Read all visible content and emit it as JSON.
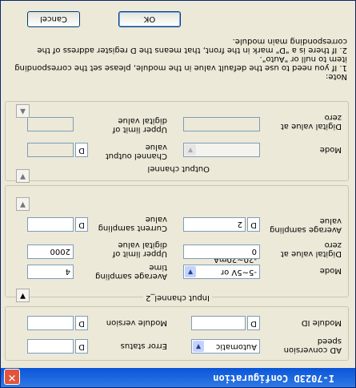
{
  "window": {
    "title": "I-7023D Configuration",
    "close_glyph": "✕"
  },
  "general": {
    "ad_conversion_label": "AD conversion speed",
    "ad_conversion_value": "Automatic",
    "error_status_label": "Error status",
    "module_id_label": "Module ID",
    "module_version_label": "Module version",
    "d_label": "D"
  },
  "input_channel": {
    "title": "Input channel_2",
    "mode_label": "Mode",
    "mode_value": "-5~5V or -20~20mA",
    "average_sampling_time_label": "Average sampling time",
    "average_sampling_time_value": "4",
    "digital_zero_label": "Digital value at zero",
    "digital_zero_value": "0",
    "upper_limit_label": "Upper limit of digital value",
    "upper_limit_value": "2000",
    "average_sampling_value_label": "Average sampling value",
    "average_sampling_value_value": "2",
    "current_sampling_value_label": "Current sampling value",
    "d_label": "D",
    "toggle_glyph": "▼"
  },
  "output_channel": {
    "title": "Output channel",
    "mode_label": "Mode",
    "channel_output_label": "Channel output value",
    "digital_zero_label": "Digital value at zero",
    "upper_limit_label": "Upper limit of digital value",
    "d_label": "D",
    "toggle_glyph": "▼"
  },
  "note": {
    "title": "Note:",
    "line1": "1. If you need to use the default value in the module, please set the corresponding item to null or \"Auto\".",
    "line2": "2. If there is a \"D\" mark in the front, that means the D register address of the corresponding main module."
  },
  "buttons": {
    "ok": "OK",
    "cancel": "Cancel"
  }
}
